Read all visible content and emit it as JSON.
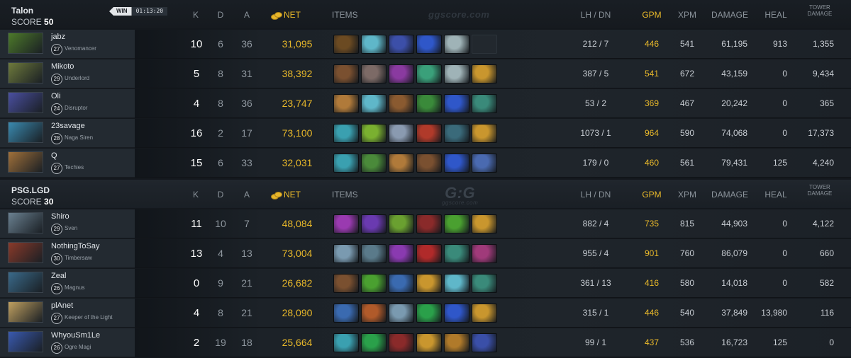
{
  "headers": {
    "k": "K",
    "d": "D",
    "a": "A",
    "net": "NET",
    "items": "ITEMS",
    "lhdn": "LH / DN",
    "gpm": "GPM",
    "xpm": "XPM",
    "damage": "DAMAGE",
    "heal": "HEAL",
    "tower_line1": "TOWER",
    "tower_line2": "DAMAGE"
  },
  "watermark_top": "ggscore.com",
  "watermark_mid": "G:G",
  "watermark_mid_sub": "ggscore.com",
  "result_badge": "WIN",
  "match_time": "01:13:20",
  "teams": [
    {
      "name": "Talon",
      "score_label": "SCORE",
      "score": "50",
      "players": [
        {
          "name": "jabz",
          "level": "27",
          "hero": "Venomancer",
          "k": "10",
          "d": "6",
          "a": "36",
          "net": "31,095",
          "lhdn": "212 / 7",
          "gpm": "446",
          "xpm": "541",
          "damage": "61,195",
          "heal": "913",
          "tower": "1,355",
          "portrait": "#4d7a2a",
          "items": [
            "#6b4a22",
            "#5fb7c9",
            "#3c4fa8",
            "#2f57c9",
            "#9fb3b7",
            "empty"
          ]
        },
        {
          "name": "Mikoto",
          "level": "29",
          "hero": "Underlord",
          "k": "5",
          "d": "8",
          "a": "31",
          "net": "38,392",
          "lhdn": "387 / 5",
          "gpm": "541",
          "xpm": "672",
          "damage": "43,159",
          "heal": "0",
          "tower": "9,434",
          "portrait": "#6e7a3c",
          "items": [
            "#7a5030",
            "#7c6a66",
            "#8a3aa0",
            "#3aa07a",
            "#9fb3b7",
            "#c9962e"
          ]
        },
        {
          "name": "Oli",
          "level": "24",
          "hero": "Disruptor",
          "k": "4",
          "d": "8",
          "a": "36",
          "net": "23,747",
          "lhdn": "53 / 2",
          "gpm": "369",
          "xpm": "467",
          "damage": "20,242",
          "heal": "0",
          "tower": "365",
          "portrait": "#4a4fa0",
          "items": [
            "#b07a3a",
            "#5fb7c9",
            "#8a5a30",
            "#3a8a3a",
            "#2f57c9",
            "#3a8a7a"
          ]
        },
        {
          "name": "23savage",
          "level": "28",
          "hero": "Naga Siren",
          "k": "16",
          "d": "2",
          "a": "17",
          "net": "73,100",
          "lhdn": "1073 / 1",
          "gpm": "964",
          "xpm": "590",
          "damage": "74,068",
          "heal": "0",
          "tower": "17,373",
          "portrait": "#3a8ab0",
          "items": [
            "#3aa0b0",
            "#7ab030",
            "#8a9ab0",
            "#b03a2a",
            "#3a6a7a",
            "#c9962e"
          ]
        },
        {
          "name": "Q",
          "level": "27",
          "hero": "Techies",
          "k": "15",
          "d": "6",
          "a": "33",
          "net": "32,031",
          "lhdn": "179 / 0",
          "gpm": "460",
          "xpm": "561",
          "damage": "79,431",
          "heal": "125",
          "tower": "4,240",
          "portrait": "#a0703a",
          "items": [
            "#3aa0b0",
            "#4a8a3a",
            "#b07a3a",
            "#7a5030",
            "#2f57c9",
            "#4a6ab0"
          ]
        }
      ]
    },
    {
      "name": "PSG.LGD",
      "score_label": "SCORE",
      "score": "30",
      "players": [
        {
          "name": "Shiro",
          "level": "29",
          "hero": "Sven",
          "k": "11",
          "d": "10",
          "a": "7",
          "net": "48,084",
          "lhdn": "882 / 4",
          "gpm": "735",
          "xpm": "815",
          "damage": "44,903",
          "heal": "0",
          "tower": "4,122",
          "portrait": "#6a8090",
          "items": [
            "#9a3ab0",
            "#6a3ab0",
            "#6aa030",
            "#8a2a2a",
            "#4aa030",
            "#c9962e"
          ]
        },
        {
          "name": "NothingToSay",
          "level": "30",
          "hero": "Timbersaw",
          "k": "13",
          "d": "4",
          "a": "13",
          "net": "73,004",
          "lhdn": "955 / 4",
          "gpm": "901",
          "xpm": "760",
          "damage": "86,079",
          "heal": "0",
          "tower": "660",
          "portrait": "#8a3a2a",
          "items": [
            "#7a9ab0",
            "#5a7a8a",
            "#8a3ab0",
            "#b02a2a",
            "#3a8a7a",
            "#a03a7a"
          ]
        },
        {
          "name": "Zeal",
          "level": "26",
          "hero": "Magnus",
          "k": "0",
          "d": "9",
          "a": "21",
          "net": "26,682",
          "lhdn": "361 / 13",
          "gpm": "416",
          "xpm": "580",
          "damage": "14,018",
          "heal": "0",
          "tower": "582",
          "portrait": "#3a6a8a",
          "items": [
            "#7a5030",
            "#4aa030",
            "#3a6ab0",
            "#c9962e",
            "#5fb7c9",
            "#3a8a7a"
          ]
        },
        {
          "name": "plAnet",
          "level": "27",
          "hero": "Keeper of the Light",
          "k": "4",
          "d": "8",
          "a": "21",
          "net": "28,090",
          "lhdn": "315 / 1",
          "gpm": "446",
          "xpm": "540",
          "damage": "37,849",
          "heal": "13,980",
          "tower": "116",
          "portrait": "#c0a060",
          "items": [
            "#3a6ab0",
            "#b05a2a",
            "#7a9ab0",
            "#2aa04a",
            "#2f57c9",
            "#c9962e"
          ]
        },
        {
          "name": "WhyouSm1Le",
          "level": "26",
          "hero": "Ogre Magi",
          "k": "2",
          "d": "19",
          "a": "18",
          "net": "25,664",
          "lhdn": "99 / 1",
          "gpm": "437",
          "xpm": "536",
          "damage": "16,723",
          "heal": "125",
          "tower": "0",
          "portrait": "#3a5ab0",
          "items": [
            "#3aa0b0",
            "#2aa04a",
            "#8a2a2a",
            "#c9962e",
            "#b07a2a",
            "#3a4fa8"
          ]
        }
      ]
    }
  ]
}
